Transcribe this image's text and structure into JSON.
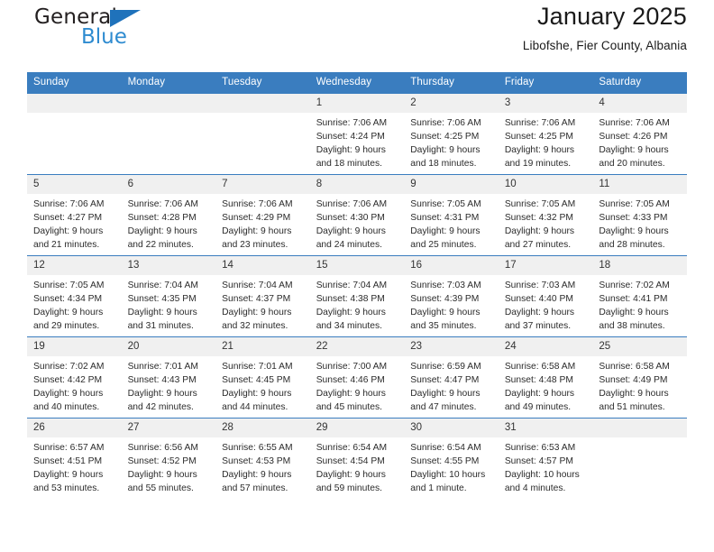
{
  "logo": {
    "word_top": "General",
    "word_bottom": "Blue",
    "flag_icon": "blue-flag-triangle",
    "color_dark": "#231f20",
    "color_blue": "#2e8bd0"
  },
  "header": {
    "title": "January 2025",
    "subtitle": "Libofshe, Fier County, Albania"
  },
  "theme": {
    "header_blue": "#3a7dbf",
    "daynum_gray": "#f0f0f0"
  },
  "weekdays": [
    "Sunday",
    "Monday",
    "Tuesday",
    "Wednesday",
    "Thursday",
    "Friday",
    "Saturday"
  ],
  "weeks": [
    [
      {
        "day": "",
        "empty": true
      },
      {
        "day": "",
        "empty": true
      },
      {
        "day": "",
        "empty": true
      },
      {
        "day": "1",
        "sunrise": "Sunrise: 7:06 AM",
        "sunset": "Sunset: 4:24 PM",
        "daylight": "Daylight: 9 hours and 18 minutes."
      },
      {
        "day": "2",
        "sunrise": "Sunrise: 7:06 AM",
        "sunset": "Sunset: 4:25 PM",
        "daylight": "Daylight: 9 hours and 18 minutes."
      },
      {
        "day": "3",
        "sunrise": "Sunrise: 7:06 AM",
        "sunset": "Sunset: 4:25 PM",
        "daylight": "Daylight: 9 hours and 19 minutes."
      },
      {
        "day": "4",
        "sunrise": "Sunrise: 7:06 AM",
        "sunset": "Sunset: 4:26 PM",
        "daylight": "Daylight: 9 hours and 20 minutes."
      }
    ],
    [
      {
        "day": "5",
        "sunrise": "Sunrise: 7:06 AM",
        "sunset": "Sunset: 4:27 PM",
        "daylight": "Daylight: 9 hours and 21 minutes."
      },
      {
        "day": "6",
        "sunrise": "Sunrise: 7:06 AM",
        "sunset": "Sunset: 4:28 PM",
        "daylight": "Daylight: 9 hours and 22 minutes."
      },
      {
        "day": "7",
        "sunrise": "Sunrise: 7:06 AM",
        "sunset": "Sunset: 4:29 PM",
        "daylight": "Daylight: 9 hours and 23 minutes."
      },
      {
        "day": "8",
        "sunrise": "Sunrise: 7:06 AM",
        "sunset": "Sunset: 4:30 PM",
        "daylight": "Daylight: 9 hours and 24 minutes."
      },
      {
        "day": "9",
        "sunrise": "Sunrise: 7:05 AM",
        "sunset": "Sunset: 4:31 PM",
        "daylight": "Daylight: 9 hours and 25 minutes."
      },
      {
        "day": "10",
        "sunrise": "Sunrise: 7:05 AM",
        "sunset": "Sunset: 4:32 PM",
        "daylight": "Daylight: 9 hours and 27 minutes."
      },
      {
        "day": "11",
        "sunrise": "Sunrise: 7:05 AM",
        "sunset": "Sunset: 4:33 PM",
        "daylight": "Daylight: 9 hours and 28 minutes."
      }
    ],
    [
      {
        "day": "12",
        "sunrise": "Sunrise: 7:05 AM",
        "sunset": "Sunset: 4:34 PM",
        "daylight": "Daylight: 9 hours and 29 minutes."
      },
      {
        "day": "13",
        "sunrise": "Sunrise: 7:04 AM",
        "sunset": "Sunset: 4:35 PM",
        "daylight": "Daylight: 9 hours and 31 minutes."
      },
      {
        "day": "14",
        "sunrise": "Sunrise: 7:04 AM",
        "sunset": "Sunset: 4:37 PM",
        "daylight": "Daylight: 9 hours and 32 minutes."
      },
      {
        "day": "15",
        "sunrise": "Sunrise: 7:04 AM",
        "sunset": "Sunset: 4:38 PM",
        "daylight": "Daylight: 9 hours and 34 minutes."
      },
      {
        "day": "16",
        "sunrise": "Sunrise: 7:03 AM",
        "sunset": "Sunset: 4:39 PM",
        "daylight": "Daylight: 9 hours and 35 minutes."
      },
      {
        "day": "17",
        "sunrise": "Sunrise: 7:03 AM",
        "sunset": "Sunset: 4:40 PM",
        "daylight": "Daylight: 9 hours and 37 minutes."
      },
      {
        "day": "18",
        "sunrise": "Sunrise: 7:02 AM",
        "sunset": "Sunset: 4:41 PM",
        "daylight": "Daylight: 9 hours and 38 minutes."
      }
    ],
    [
      {
        "day": "19",
        "sunrise": "Sunrise: 7:02 AM",
        "sunset": "Sunset: 4:42 PM",
        "daylight": "Daylight: 9 hours and 40 minutes."
      },
      {
        "day": "20",
        "sunrise": "Sunrise: 7:01 AM",
        "sunset": "Sunset: 4:43 PM",
        "daylight": "Daylight: 9 hours and 42 minutes."
      },
      {
        "day": "21",
        "sunrise": "Sunrise: 7:01 AM",
        "sunset": "Sunset: 4:45 PM",
        "daylight": "Daylight: 9 hours and 44 minutes."
      },
      {
        "day": "22",
        "sunrise": "Sunrise: 7:00 AM",
        "sunset": "Sunset: 4:46 PM",
        "daylight": "Daylight: 9 hours and 45 minutes."
      },
      {
        "day": "23",
        "sunrise": "Sunrise: 6:59 AM",
        "sunset": "Sunset: 4:47 PM",
        "daylight": "Daylight: 9 hours and 47 minutes."
      },
      {
        "day": "24",
        "sunrise": "Sunrise: 6:58 AM",
        "sunset": "Sunset: 4:48 PM",
        "daylight": "Daylight: 9 hours and 49 minutes."
      },
      {
        "day": "25",
        "sunrise": "Sunrise: 6:58 AM",
        "sunset": "Sunset: 4:49 PM",
        "daylight": "Daylight: 9 hours and 51 minutes."
      }
    ],
    [
      {
        "day": "26",
        "sunrise": "Sunrise: 6:57 AM",
        "sunset": "Sunset: 4:51 PM",
        "daylight": "Daylight: 9 hours and 53 minutes."
      },
      {
        "day": "27",
        "sunrise": "Sunrise: 6:56 AM",
        "sunset": "Sunset: 4:52 PM",
        "daylight": "Daylight: 9 hours and 55 minutes."
      },
      {
        "day": "28",
        "sunrise": "Sunrise: 6:55 AM",
        "sunset": "Sunset: 4:53 PM",
        "daylight": "Daylight: 9 hours and 57 minutes."
      },
      {
        "day": "29",
        "sunrise": "Sunrise: 6:54 AM",
        "sunset": "Sunset: 4:54 PM",
        "daylight": "Daylight: 9 hours and 59 minutes."
      },
      {
        "day": "30",
        "sunrise": "Sunrise: 6:54 AM",
        "sunset": "Sunset: 4:55 PM",
        "daylight": "Daylight: 10 hours and 1 minute."
      },
      {
        "day": "31",
        "sunrise": "Sunrise: 6:53 AM",
        "sunset": "Sunset: 4:57 PM",
        "daylight": "Daylight: 10 hours and 4 minutes."
      },
      {
        "day": "",
        "empty": true
      }
    ]
  ]
}
